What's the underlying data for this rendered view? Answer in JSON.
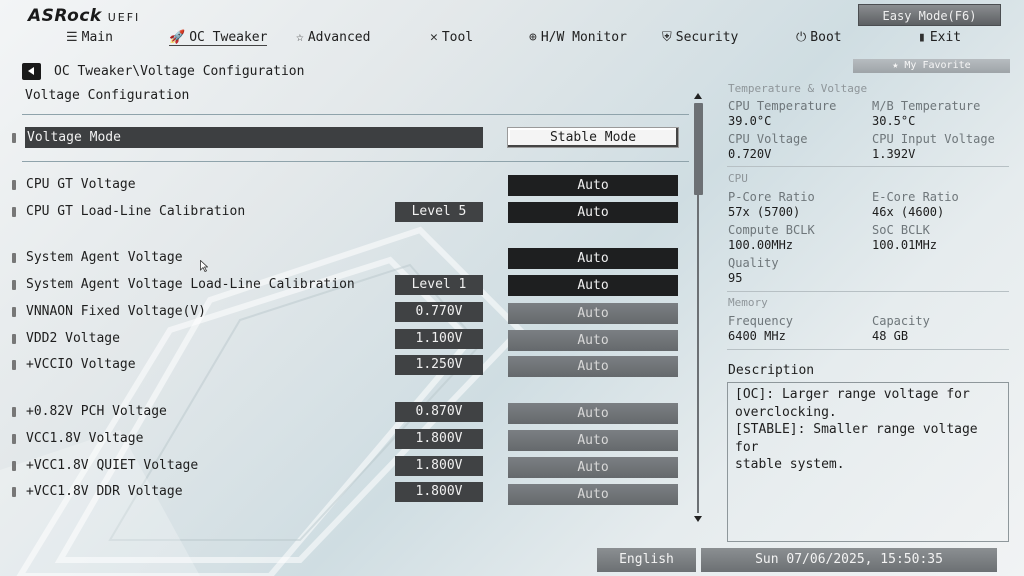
{
  "brand": {
    "name": "ASRock",
    "suffix": "UEFI"
  },
  "easy_mode_label": "Easy Mode(F6)",
  "nav": [
    {
      "label": "Main",
      "icon": "list-icon"
    },
    {
      "label": "OC Tweaker",
      "icon": "rocket-icon",
      "active": true
    },
    {
      "label": "Advanced",
      "icon": "star-icon"
    },
    {
      "label": "Tool",
      "icon": "tools-icon"
    },
    {
      "label": "H/W Monitor",
      "icon": "monitor-icon"
    },
    {
      "label": "Security",
      "icon": "shield-icon"
    },
    {
      "label": "Boot",
      "icon": "power-icon"
    },
    {
      "label": "Exit",
      "icon": "exit-door-icon"
    }
  ],
  "breadcrumb": "OC Tweaker\\Voltage Configuration",
  "page_title": "Voltage Configuration",
  "my_favorite": "★ My Favorite",
  "voltage_mode": {
    "label": "Voltage Mode",
    "value": "Stable Mode"
  },
  "rows": [
    {
      "label": "CPU GT Voltage",
      "value": "",
      "option": "Auto",
      "enabled": true
    },
    {
      "label": "CPU GT Load-Line Calibration",
      "value": "Level 5",
      "option": "Auto",
      "enabled": true
    },
    {
      "label": "System Agent Voltage",
      "value": "",
      "option": "Auto",
      "enabled": true
    },
    {
      "label": "System Agent Voltage Load-Line Calibration",
      "value": "Level 1",
      "option": "Auto",
      "enabled": true
    },
    {
      "label": "VNNAON Fixed Voltage(V)",
      "value": "0.770V",
      "option": "Auto",
      "enabled": false
    },
    {
      "label": "VDD2 Voltage",
      "value": "1.100V",
      "option": "Auto",
      "enabled": false
    },
    {
      "label": "+VCCIO Voltage",
      "value": "1.250V",
      "option": "Auto",
      "enabled": false
    },
    {
      "label": "+0.82V PCH Voltage",
      "value": "0.870V",
      "option": "Auto",
      "enabled": false
    },
    {
      "label": "VCC1.8V Voltage",
      "value": "1.800V",
      "option": "Auto",
      "enabled": false
    },
    {
      "label": "+VCC1.8V QUIET Voltage",
      "value": "1.800V",
      "option": "Auto",
      "enabled": false
    },
    {
      "label": "+VCC1.8V DDR Voltage",
      "value": "1.800V",
      "option": "Auto",
      "enabled": false
    }
  ],
  "info": {
    "temp_voltage": {
      "title": "Temperature & Voltage",
      "cpu_temp_label": "CPU Temperature",
      "cpu_temp": "39.0°C",
      "mb_temp_label": "M/B Temperature",
      "mb_temp": "30.5°C",
      "cpu_voltage_label": "CPU Voltage",
      "cpu_voltage": "0.720V",
      "cpu_input_label": "CPU Input Voltage",
      "cpu_input": "1.392V"
    },
    "cpu": {
      "title": "CPU",
      "pcore_label": "P-Core Ratio",
      "pcore": "57x (5700)",
      "ecore_label": "E-Core Ratio",
      "ecore": "46x (4600)",
      "bclk_label": "Compute BCLK",
      "bclk": "100.00MHz",
      "soc_label": "SoC BCLK",
      "soc": "100.01MHz",
      "quality_label": "Quality",
      "quality": "95"
    },
    "memory": {
      "title": "Memory",
      "freq_label": "Frequency",
      "freq": "6400 MHz",
      "cap_label": "Capacity",
      "cap": "48 GB"
    }
  },
  "description": {
    "title": "Description",
    "lines": [
      "[OC]: Larger range voltage for",
      "overclocking.",
      "[STABLE]: Smaller range voltage for",
      "stable system."
    ]
  },
  "footer": {
    "language": "English",
    "datetime": "Sun 07/06/2025, 15:50:35"
  },
  "colors": {
    "selected_row": "#3d3f41",
    "active_option": "#1e1f20",
    "disabled_option": "#6f7377"
  }
}
